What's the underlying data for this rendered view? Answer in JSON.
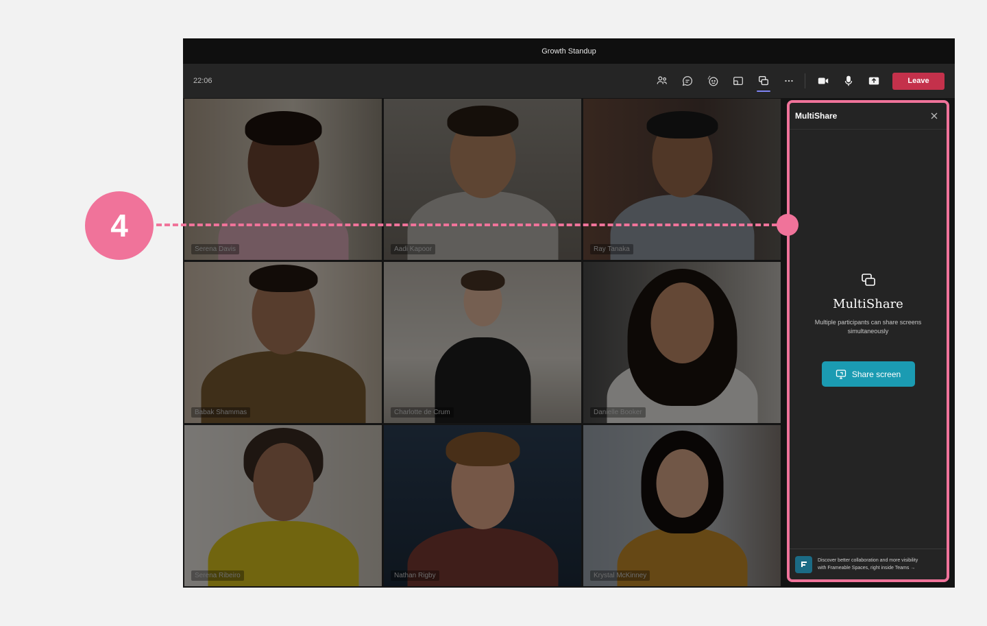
{
  "window": {
    "title": "Growth Standup"
  },
  "toolbar": {
    "time": "22:06",
    "icons": [
      "people-icon",
      "chat-icon",
      "reactions-icon",
      "rooms-icon",
      "multishare-icon",
      "more-icon",
      "camera-icon",
      "mic-icon",
      "share-tray-icon"
    ],
    "leave_label": "Leave",
    "leave_color": "#c4314b"
  },
  "participants": [
    {
      "name": "Serena Davis"
    },
    {
      "name": "Aadi Kapoor"
    },
    {
      "name": "Ray Tanaka"
    },
    {
      "name": "Babak Shammas"
    },
    {
      "name": "Charlotte de Crum"
    },
    {
      "name": "Danielle Booker"
    },
    {
      "name": "Serena Ribeiro"
    },
    {
      "name": "Nathan Rigby"
    },
    {
      "name": "Krystal McKinney"
    }
  ],
  "panel": {
    "title": "MultiShare",
    "heading": "MultiShare",
    "description": "Multiple participants can share screens simultaneously",
    "share_button": "Share screen",
    "footer_line1": "Discover better collaboration and more visibility",
    "footer_line2": "with Frameable Spaces, right inside Teams →",
    "accent": "#1b9bb2",
    "highlight": "#f0739a"
  },
  "callout": {
    "number": "4"
  }
}
